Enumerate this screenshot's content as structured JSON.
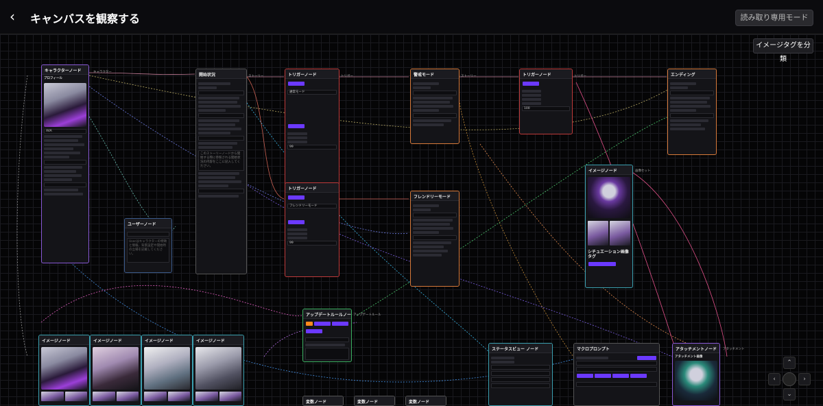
{
  "header": {
    "back_icon": "chevron-left-icon",
    "title": "キャンバスを観察する",
    "readonly_button": "読み取り専用モード"
  },
  "canvas": {
    "classify_button": "イメージタグを分類"
  },
  "nodes": {
    "character": {
      "title": "キャラクターノード",
      "subtitle": "プロフィール",
      "name_value": "AVA",
      "link_label": "キャラクター"
    },
    "user": {
      "title": "ユーザーノード",
      "placeholder": "Userはキャラクターの特徴と情報、背景設定や開始時の立場を記載してください。"
    },
    "start": {
      "title": "開始状況",
      "story_placeholder": "このストーリーノードから開始する際に参照される開始状況の内容をここに記入してください。"
    },
    "trigger1": {
      "title": "トリガーノード",
      "value": "通常モード",
      "num": "99"
    },
    "trigger2": {
      "title": "トリガーノード",
      "value": "フレンドリーモード",
      "num": "99"
    },
    "trigger3": {
      "title": "トリガーノード",
      "num": "100"
    },
    "caution": {
      "title": "警戒モード"
    },
    "friendly": {
      "title": "フレンドリーモード"
    },
    "ending": {
      "title": "エンディング"
    },
    "image_big": {
      "title": "イメージノード",
      "caption": "シチュエーション画像タグ"
    },
    "update_rule": {
      "title": "アップデートルールノード"
    },
    "status_view": {
      "title": "ステータスビュー ノード"
    },
    "macro": {
      "title": "マクロプロンプト"
    },
    "attachment": {
      "title": "アタッチメントノード",
      "subtitle": "アタッチメント画像"
    },
    "img_a": {
      "title": "イメージノード"
    },
    "img_b": {
      "title": "イメージノード"
    },
    "img_c": {
      "title": "イメージノード"
    },
    "img_d": {
      "title": "イメージノード"
    },
    "var_a": {
      "title": "変数ノード"
    },
    "var_b": {
      "title": "変数ノード"
    },
    "var_c": {
      "title": "変数ノード"
    }
  },
  "port_labels": {
    "story": "ストーリー",
    "trigger": "トリガー",
    "character": "キャラクター",
    "update": "アップデートルール",
    "attachment": "アタッチメント",
    "imageset": "画像セット"
  },
  "controls": {
    "up_icon": "chevron-up-icon",
    "down_icon": "chevron-down-icon",
    "left_icon": "chevron-left-icon",
    "right_icon": "chevron-right-icon"
  }
}
